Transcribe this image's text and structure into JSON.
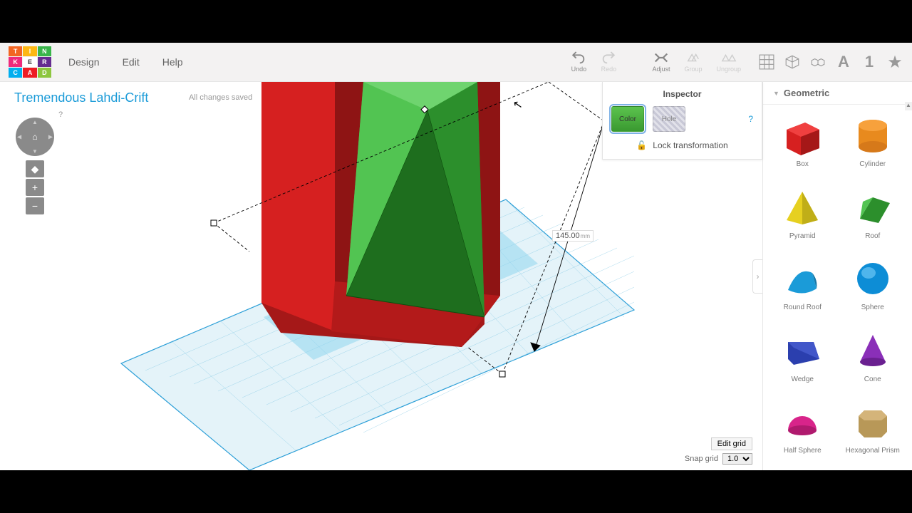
{
  "logo_letters": [
    "T",
    "I",
    "N",
    "K",
    "E",
    "R",
    "C",
    "A",
    "D"
  ],
  "menu": {
    "design": "Design",
    "edit": "Edit",
    "help": "Help"
  },
  "toolbar": {
    "undo": "Undo",
    "redo": "Redo",
    "adjust": "Adjust",
    "group": "Group",
    "ungroup": "Ungroup"
  },
  "right_icons_annot": "A 1",
  "project": {
    "title": "Tremendous Lahdi-Crift",
    "save_status": "All changes saved"
  },
  "viewcube": {
    "help": "?"
  },
  "dimension": {
    "value": "145.00",
    "unit": "mm"
  },
  "grid_controls": {
    "edit": "Edit grid",
    "snap_label": "Snap grid",
    "snap_value": "1.0"
  },
  "inspector": {
    "title": "Inspector",
    "color": "Color",
    "hole": "Hole",
    "help": "?",
    "lock": "Lock transformation"
  },
  "sidebar": {
    "category": "Geometric"
  },
  "shapes": [
    {
      "label": "Box"
    },
    {
      "label": "Cylinder"
    },
    {
      "label": "Pyramid"
    },
    {
      "label": "Roof"
    },
    {
      "label": "Round Roof"
    },
    {
      "label": "Sphere"
    },
    {
      "label": "Wedge"
    },
    {
      "label": "Cone"
    },
    {
      "label": "Half Sphere"
    },
    {
      "label": "Hexagonal Prism"
    }
  ]
}
